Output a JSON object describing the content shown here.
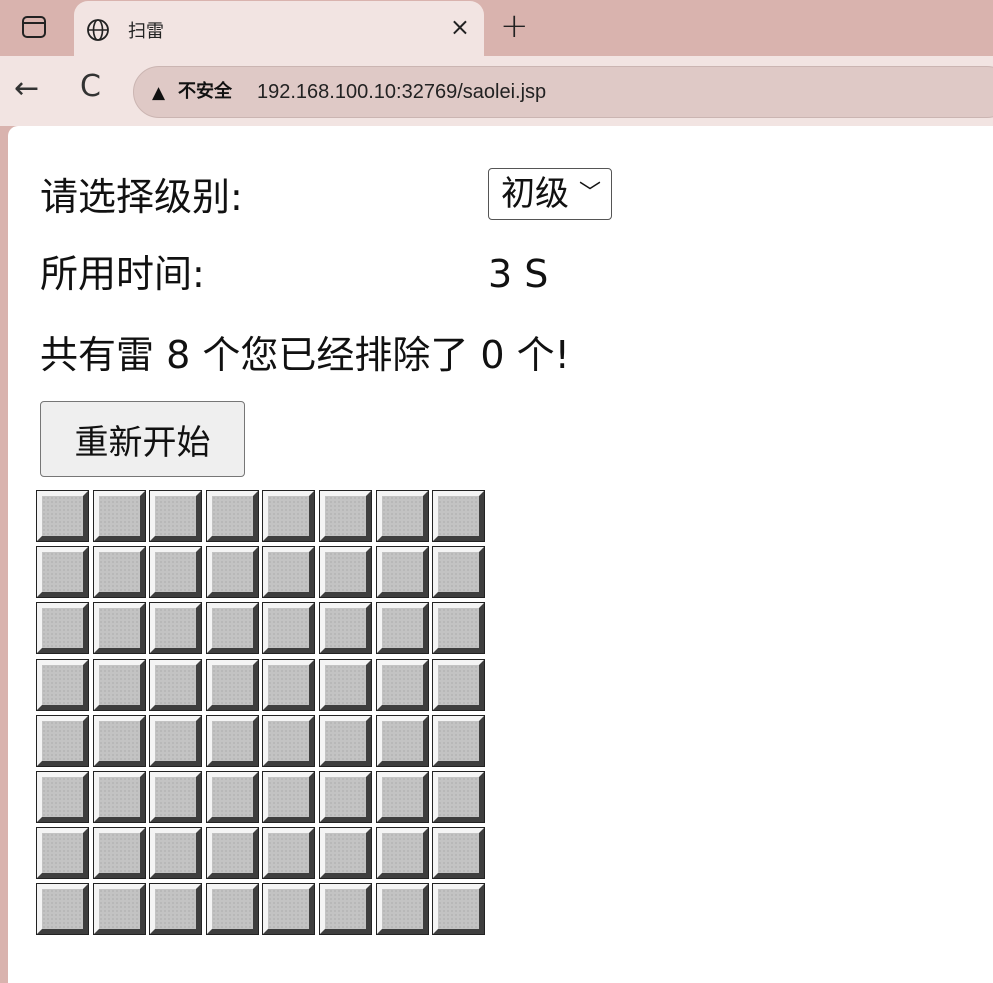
{
  "browser": {
    "tab_title": "扫雷",
    "tab_close": "×",
    "new_tab": "+",
    "back": "←",
    "reload": "C",
    "security_icon": "▲",
    "security_label": "不安全",
    "url": "192.168.100.10:32769/saolei.jsp"
  },
  "game": {
    "level_label": "请选择级别:",
    "level_value": "初级",
    "level_chevron": "﹀",
    "time_label": "所用时间:",
    "time_value": "3 S",
    "mine_status": "共有雷 8 个您已经排除了 0 个!",
    "restart_label": "重新开始",
    "board": {
      "rows": 8,
      "cols": 8,
      "cell_state": "covered"
    }
  },
  "colors": {
    "chrome_tabbar": "#d9b3ae",
    "chrome_toolbar": "#f2e4e2",
    "cell_face": "#c3c3c3"
  }
}
